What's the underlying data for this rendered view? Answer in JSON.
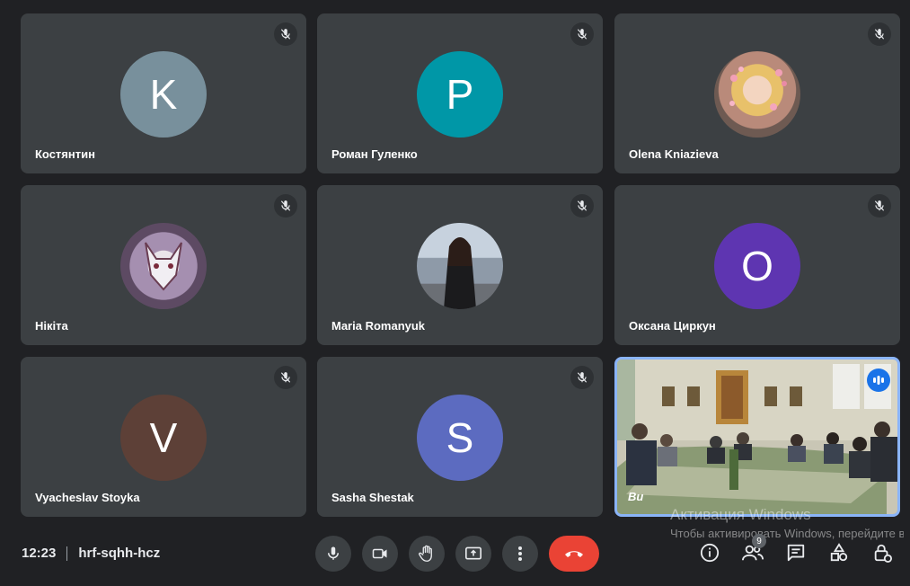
{
  "participants": [
    {
      "name": "Костянтин",
      "initial": "K",
      "color": "#78909c"
    },
    {
      "name": "Роман Гуленко",
      "initial": "P",
      "color": "#0097a7"
    },
    {
      "name": "Olena Kniazieva",
      "initial": "",
      "color": "#c9a9a6"
    },
    {
      "name": "Нікіта",
      "initial": "",
      "color": "#8d7b92"
    },
    {
      "name": "Maria Romanyuk",
      "initial": "",
      "color": "#9aa0a6"
    },
    {
      "name": "Оксана Циркун",
      "initial": "O",
      "color": "#5e35b1"
    },
    {
      "name": "Vyacheslav Stoyka",
      "initial": "V",
      "color": "#5d4037"
    },
    {
      "name": "Sasha Shestak",
      "initial": "S",
      "color": "#5c6bc0"
    }
  ],
  "self_view": {
    "name": "Ви"
  },
  "meeting": {
    "time": "12:23",
    "code": "hrf-sqhh-hcz"
  },
  "people_count": "9",
  "watermark": {
    "line1": "Активация Windows",
    "line2": "Чтобы активировать Windows, перейдите в раздел \"Параметры\"."
  },
  "colors": {
    "end_call": "#ea4335",
    "speaking": "#1a73e8",
    "self_border": "#8ab4f8"
  },
  "icons": [
    "mic-off-icon",
    "mic-icon",
    "camera-icon",
    "hand-icon",
    "present-icon",
    "more-vert-icon",
    "call-end-icon",
    "info-icon",
    "people-icon",
    "chat-icon",
    "activities-icon",
    "host-controls-icon"
  ]
}
